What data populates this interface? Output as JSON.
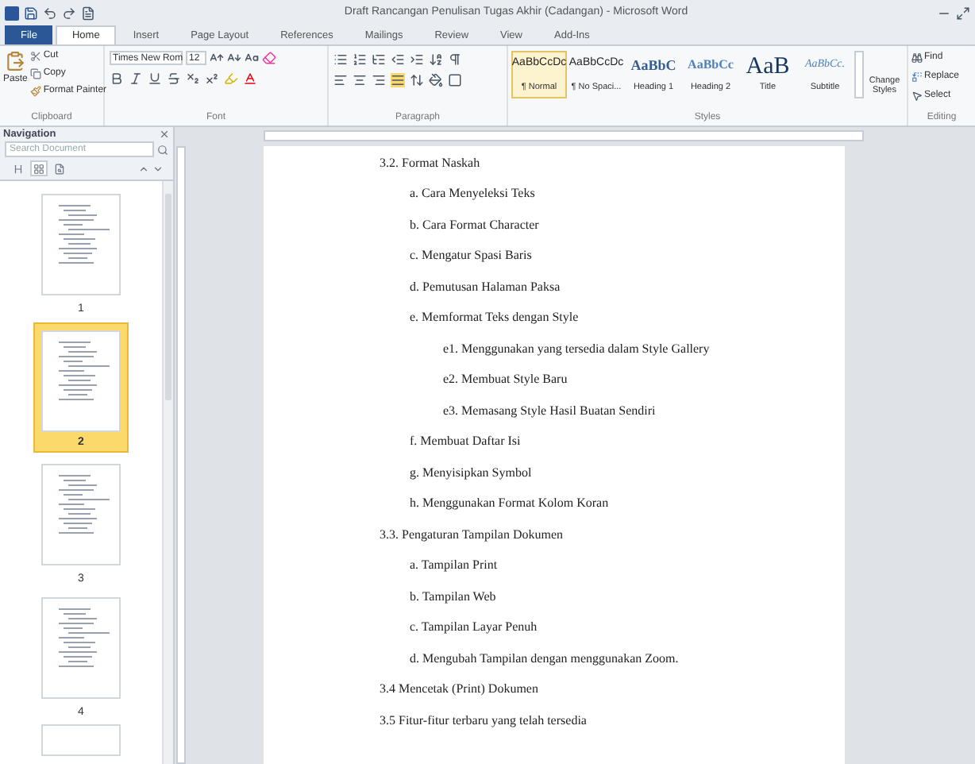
{
  "window": {
    "title": "Draft Rancangan Penulisan Tugas Akhir (Cadangan)  -  Microsoft Word"
  },
  "ribbon": {
    "tabs": [
      {
        "label": "File",
        "kind": "file",
        "selected": false
      },
      {
        "label": "Home",
        "kind": "tab",
        "selected": true
      },
      {
        "label": "Insert",
        "kind": "tab",
        "selected": false
      },
      {
        "label": "Page Layout",
        "kind": "tab",
        "selected": false
      },
      {
        "label": "References",
        "kind": "tab",
        "selected": false
      },
      {
        "label": "Mailings",
        "kind": "tab",
        "selected": false
      },
      {
        "label": "Review",
        "kind": "tab",
        "selected": false
      },
      {
        "label": "View",
        "kind": "tab",
        "selected": false
      },
      {
        "label": "Add-Ins",
        "kind": "tab",
        "selected": false
      }
    ],
    "clipboard": {
      "paste": "Paste",
      "cut": "Cut",
      "copy": "Copy",
      "format_painter": "Format Painter",
      "label": "Clipboard"
    },
    "font": {
      "name": "Times New Rom",
      "size": "12",
      "label": "Font"
    },
    "paragraph": {
      "label": "Paragraph"
    },
    "styles": {
      "label": "Styles",
      "items": [
        {
          "sample": "AaBbCcDc",
          "name": "¶ Normal",
          "kind": "normal",
          "selected": true
        },
        {
          "sample": "AaBbCcDc",
          "name": "¶ No Spaci...",
          "kind": "normal",
          "selected": false
        },
        {
          "sample": "AaBbC",
          "name": "Heading 1",
          "kind": "heading1",
          "selected": false
        },
        {
          "sample": "AaBbCc",
          "name": "Heading 2",
          "kind": "heading2",
          "selected": false
        },
        {
          "sample": "AaB",
          "name": "Title",
          "kind": "title",
          "selected": false
        },
        {
          "sample": "AaBbCc.",
          "name": "Subtitle",
          "kind": "subtitle",
          "selected": false
        }
      ],
      "change_styles": "Change Styles"
    },
    "editing": {
      "label": "Editing",
      "find": "Find",
      "replace": "Replace",
      "select": "Select"
    }
  },
  "navigation": {
    "title": "Navigation",
    "search": {
      "placeholder": "Search Document"
    },
    "views": [
      {
        "kind": "headings",
        "selected": false
      },
      {
        "kind": "pages",
        "selected": true
      },
      {
        "kind": "results",
        "selected": false
      }
    ],
    "pages": [
      {
        "number": "1",
        "selected": false
      },
      {
        "number": "2",
        "selected": true
      },
      {
        "number": "3",
        "selected": false
      },
      {
        "number": "4",
        "selected": false
      }
    ]
  },
  "document": {
    "items": [
      {
        "text": "3.2. Format Naskah",
        "children": [
          {
            "text": "a. Cara Menyeleksi Teks"
          },
          {
            "text": "b. Cara Format Character"
          },
          {
            "text": "c. Mengatur Spasi Baris"
          },
          {
            "text": "d. Pemutusan Halaman Paksa"
          },
          {
            "text": "e. Memformat Teks dengan Style",
            "children": [
              {
                "text": "e1. Menggunakan yang tersedia dalam Style Gallery"
              },
              {
                "text": "e2. Membuat Style Baru"
              },
              {
                "text": "e3. Memasang Style Hasil Buatan Sendiri"
              }
            ]
          },
          {
            "text": "f. Membuat Daftar Isi"
          },
          {
            "text": "g. Menyisipkan Symbol"
          },
          {
            "text": "h. Menggunakan Format Kolom Koran"
          }
        ]
      },
      {
        "text": "3.3. Pengaturan Tampilan Dokumen",
        "children": [
          {
            "text": "a. Tampilan Print"
          },
          {
            "text": "b. Tampilan Web"
          },
          {
            "text": "c. Tampilan Layar Penuh"
          },
          {
            "text": "d. Mengubah Tampilan dengan menggunakan Zoom."
          }
        ]
      },
      {
        "text": "3.4 Mencetak (Print) Dokumen"
      },
      {
        "text": "3.5 Fitur-fitur terbaru yang telah tersedia"
      }
    ]
  }
}
